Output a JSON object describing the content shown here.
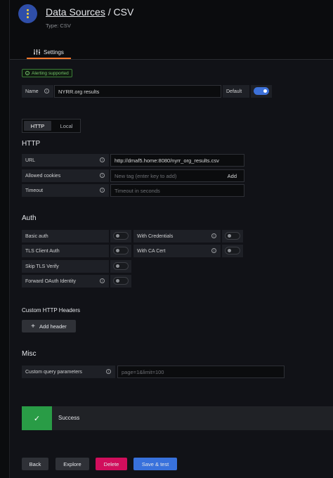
{
  "header": {
    "title_link": "Data Sources",
    "title_rest": " / CSV",
    "subtitle": "Type: CSV",
    "tab_settings": "Settings"
  },
  "alerting_badge": "Alerting supported",
  "name_row": {
    "label": "Name",
    "value": "NYRR.org results",
    "default_label": "Default",
    "default_on": true
  },
  "mode_tabs": [
    "HTTP",
    "Local"
  ],
  "http": {
    "section_title": "HTTP",
    "url_label": "URL",
    "url_value": "http://dmaf5.home:8080/nyrr_org_results.csv",
    "allowed_cookies_label": "Allowed cookies",
    "allowed_cookies_placeholder": "New tag (enter key to add)",
    "add_label": "Add",
    "timeout_label": "Timeout",
    "timeout_placeholder": "Timeout in seconds"
  },
  "auth": {
    "section_title": "Auth",
    "basic_auth": "Basic auth",
    "with_credentials": "With Credentials",
    "tls_client_auth": "TLS Client Auth",
    "with_ca_cert": "With CA Cert",
    "skip_tls_verify": "Skip TLS Verify",
    "forward_oauth": "Forward OAuth Identity"
  },
  "custom_headers": {
    "section_title": "Custom HTTP Headers",
    "add_header": "Add header"
  },
  "misc": {
    "section_title": "Misc",
    "query_params_label": "Custom query parameters",
    "query_params_placeholder": "page=1&limit=100"
  },
  "status": {
    "text": "Success"
  },
  "footer": {
    "back": "Back",
    "explore": "Explore",
    "delete": "Delete",
    "save_test": "Save & test"
  },
  "colors": {
    "accent_blue": "#3871dc",
    "danger": "#d10e5c",
    "success": "#299c46",
    "tab_underline": "#ff7a2d"
  }
}
